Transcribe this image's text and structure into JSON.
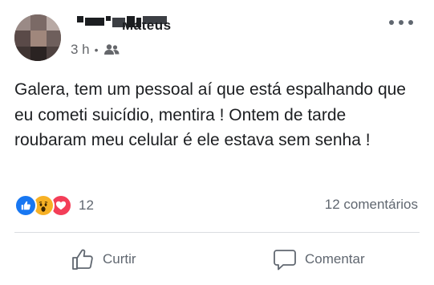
{
  "post": {
    "time": "3 h",
    "separator": "•",
    "audience_icon": "friends-icon",
    "more_icon": "more-options-icon",
    "text": "Galera, tem um pessoal aí que está espalhando que eu cometi suicídio, mentira ! Ontem de tarde roubaram meu celular é ele estava sem senha !",
    "author_visible": "Mateus"
  },
  "reactions": {
    "icons": [
      "like-reaction-icon",
      "wow-reaction-icon",
      "love-reaction-icon"
    ],
    "count": "12"
  },
  "comments": {
    "count_label": "12 comentários"
  },
  "actions": {
    "like_label": "Curtir",
    "comment_label": "Comentar"
  },
  "colors": {
    "like_blue": "#1877f2",
    "wow_yellow": "#f7b125",
    "love_red": "#f33e58",
    "secondary_text": "#606770"
  }
}
